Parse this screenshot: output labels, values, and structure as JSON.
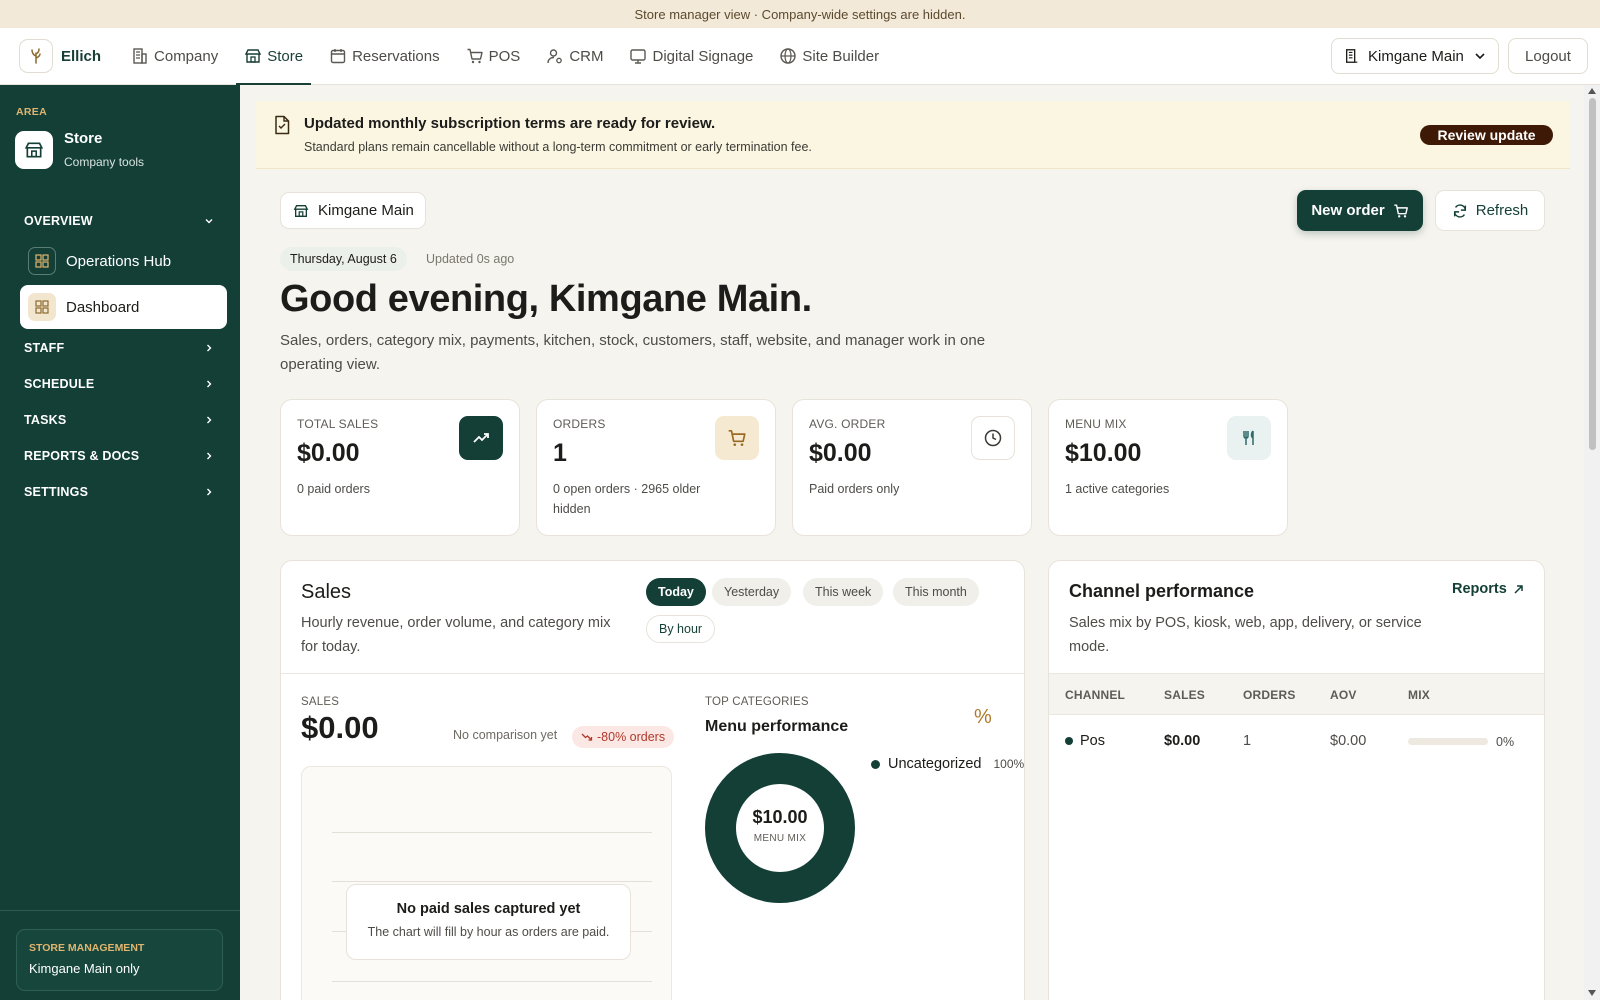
{
  "top_banner": "Store manager view · Company-wide settings are hidden.",
  "nav": {
    "brand": "Ellich",
    "items": [
      {
        "label": "Company",
        "icon": "building-icon"
      },
      {
        "label": "Store",
        "icon": "store-icon",
        "active": true
      },
      {
        "label": "Reservations",
        "icon": "calendar-icon"
      },
      {
        "label": "POS",
        "icon": "cart-icon"
      },
      {
        "label": "CRM",
        "icon": "user-gear-icon"
      },
      {
        "label": "Digital Signage",
        "icon": "monitor-icon"
      },
      {
        "label": "Site Builder",
        "icon": "globe-icon"
      }
    ],
    "store_select": "Kimgane Main",
    "logout": "Logout"
  },
  "sidebar": {
    "area_label": "AREA",
    "area_title": "Store",
    "area_sub": "Company tools",
    "sections": [
      {
        "label": "OVERVIEW",
        "expanded": true
      },
      {
        "label": "STAFF"
      },
      {
        "label": "SCHEDULE"
      },
      {
        "label": "TASKS"
      },
      {
        "label": "REPORTS & DOCS"
      },
      {
        "label": "SETTINGS"
      }
    ],
    "items": [
      {
        "label": "Operations Hub"
      },
      {
        "label": "Dashboard",
        "active": true
      }
    ],
    "footer": {
      "label": "STORE MANAGEMENT",
      "value": "Kimgane Main only"
    }
  },
  "alert": {
    "title": "Updated monthly subscription terms are ready for review.",
    "sub": "Standard plans remain cancellable without a long-term commitment or early termination fee.",
    "button": "Review update"
  },
  "header": {
    "location": "Kimgane Main",
    "new_order": "New order",
    "refresh": "Refresh",
    "date": "Thursday, August 6",
    "updated": "Updated 0s ago",
    "greeting": "Good evening, Kimgane Main.",
    "subtitle": "Sales, orders, category mix, payments, kitchen, stock, customers, staff, website, and manager work in one operating view."
  },
  "kpis": [
    {
      "label": "TOTAL SALES",
      "value": "$0.00",
      "sub": "0 paid orders",
      "icon": "trend-up-icon"
    },
    {
      "label": "ORDERS",
      "value": "1",
      "sub": "0 open orders · 2965 older hidden",
      "icon": "cart-icon"
    },
    {
      "label": "AVG. ORDER",
      "value": "$0.00",
      "sub": "Paid orders only",
      "icon": "clock-icon"
    },
    {
      "label": "MENU MIX",
      "value": "$10.00",
      "sub": "1 active categories",
      "icon": "utensils-icon"
    }
  ],
  "sales": {
    "title": "Sales",
    "subtitle": "Hourly revenue, order volume, and category mix for today.",
    "periods": [
      "Today",
      "Yesterday",
      "This week",
      "This month"
    ],
    "active_period": "Today",
    "granularity": "By hour",
    "sales_label": "SALES",
    "sales_value": "$0.00",
    "comparison": "No comparison yet",
    "orders_delta": "-80% orders",
    "empty_title": "No paid sales captured yet",
    "empty_desc": "The chart will fill by hour as orders are paid.",
    "top_cat_label": "TOP CATEGORIES",
    "top_cat_title": "Menu performance",
    "pct_symbol": "%"
  },
  "chart_data": {
    "type": "pie",
    "title": "Menu performance",
    "center_value": "$10.00",
    "center_label": "MENU MIX",
    "categories": [
      "Uncategorized"
    ],
    "values": [
      100
    ],
    "value_labels": [
      "100%"
    ],
    "colors": [
      "#133f36"
    ]
  },
  "channel": {
    "title": "Channel performance",
    "subtitle": "Sales mix by POS, kiosk, web, app, delivery, or service mode.",
    "reports": "Reports",
    "columns": [
      "CHANNEL",
      "SALES",
      "ORDERS",
      "AOV",
      "MIX"
    ],
    "rows": [
      {
        "channel": "Pos",
        "sales": "$0.00",
        "orders": "1",
        "aov": "$0.00",
        "mix": "0%",
        "mix_fraction": 0
      }
    ]
  },
  "colors": {
    "brand": "#133f36",
    "accent": "#e0b56f",
    "alert_button": "#3e1a06",
    "negative": "#b1392b"
  }
}
